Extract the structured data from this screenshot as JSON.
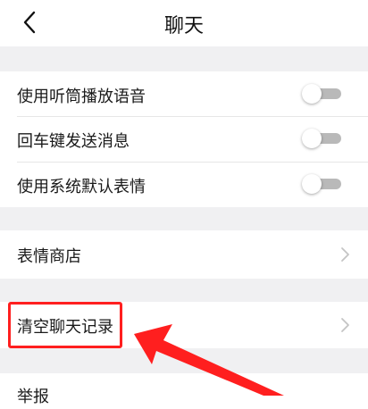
{
  "header": {
    "title": "聊天",
    "back_icon": "chevron-left-icon"
  },
  "settings": {
    "use_earpiece": {
      "label": "使用听筒播放语音",
      "enabled": false
    },
    "enter_to_send": {
      "label": "回车键发送消息",
      "enabled": false
    },
    "default_emoji": {
      "label": "使用系统默认表情",
      "enabled": false
    }
  },
  "links": {
    "sticker_store": {
      "label": "表情商店"
    },
    "clear_history": {
      "label": "清空聊天记录"
    },
    "report": {
      "label": "举报"
    }
  },
  "colors": {
    "highlight": "#ff1f1f",
    "toggle_off": "#b9b9b9",
    "page_bg": "#f0f0f2"
  }
}
